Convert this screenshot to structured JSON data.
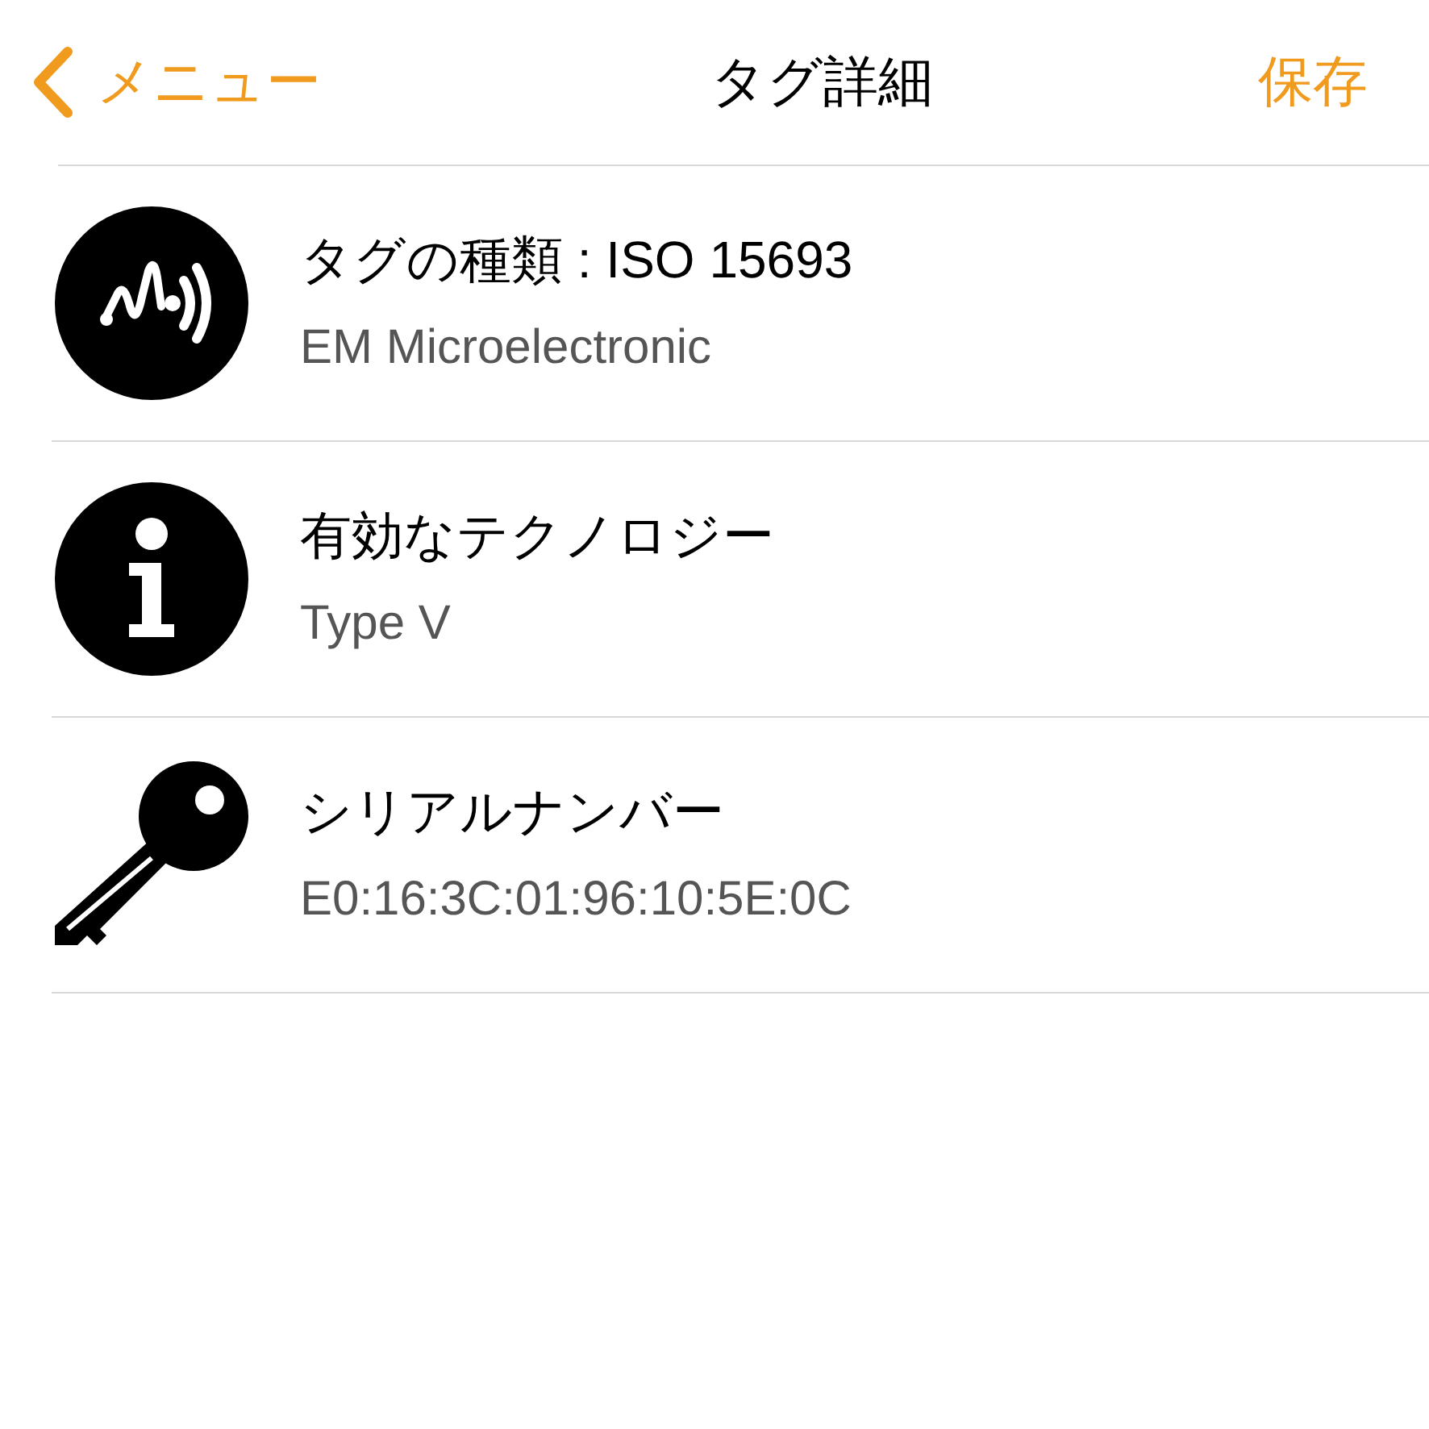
{
  "nav": {
    "back": "メニュー",
    "title": "タグ詳細",
    "action": "保存"
  },
  "rows": [
    {
      "kind": "nfc",
      "title": "タグの種類 : ISO 15693",
      "detail": "EM Microelectronic"
    },
    {
      "kind": "info",
      "title": "有効なテクノロジー",
      "detail": "Type V"
    },
    {
      "kind": "key",
      "title": "シリアルナンバー",
      "detail": "E0:16:3C:01:96:10:5E:0C"
    }
  ]
}
